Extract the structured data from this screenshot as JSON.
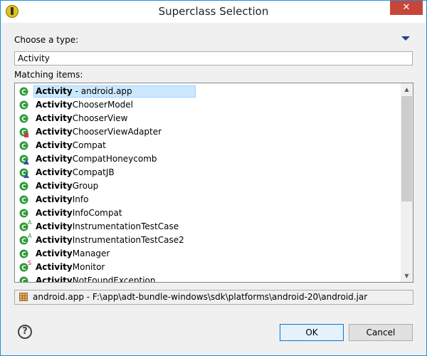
{
  "window": {
    "title": "Superclass Selection",
    "close_glyph": "✕"
  },
  "choose_label": "Choose a type:",
  "filter": {
    "value": "Activity",
    "placeholder": ""
  },
  "matching_label": "Matching items:",
  "items": [
    {
      "bold": "Activity",
      "rest": " - android.app",
      "icon": "class-icon",
      "overlay": "",
      "selected": true
    },
    {
      "bold": "Activity",
      "rest": "ChooserModel",
      "icon": "class-icon",
      "overlay": "",
      "selected": false
    },
    {
      "bold": "Activity",
      "rest": "ChooserView",
      "icon": "class-icon",
      "overlay": "",
      "selected": false
    },
    {
      "bold": "Activity",
      "rest": "ChooserViewAdapter",
      "icon": "class-icon",
      "overlay": "private-overlay",
      "selected": false
    },
    {
      "bold": "Activity",
      "rest": "Compat",
      "icon": "class-icon",
      "overlay": "",
      "selected": false
    },
    {
      "bold": "Activity",
      "rest": "CompatHoneycomb",
      "icon": "class-icon",
      "overlay": "default-overlay",
      "selected": false
    },
    {
      "bold": "Activity",
      "rest": "CompatJB",
      "icon": "class-icon",
      "overlay": "default-overlay",
      "selected": false
    },
    {
      "bold": "Activity",
      "rest": "Group",
      "icon": "class-icon",
      "overlay": "",
      "selected": false
    },
    {
      "bold": "Activity",
      "rest": "Info",
      "icon": "class-icon",
      "overlay": "",
      "selected": false
    },
    {
      "bold": "Activity",
      "rest": "InfoCompat",
      "icon": "class-icon",
      "overlay": "",
      "selected": false
    },
    {
      "bold": "Activity",
      "rest": "InstrumentationTestCase",
      "icon": "class-icon",
      "overlay": "abstract-overlay",
      "selected": false
    },
    {
      "bold": "Activity",
      "rest": "InstrumentationTestCase2",
      "icon": "class-icon",
      "overlay": "abstract-overlay",
      "selected": false
    },
    {
      "bold": "Activity",
      "rest": "Manager",
      "icon": "class-icon",
      "overlay": "",
      "selected": false
    },
    {
      "bold": "Activity",
      "rest": "Monitor",
      "icon": "class-icon",
      "overlay": "static-overlay",
      "selected": false
    },
    {
      "bold": "Activity",
      "rest": "NotFoundException",
      "icon": "class-icon",
      "overlay": "",
      "selected": false
    }
  ],
  "status": {
    "text": "android.app - F:\\app\\adt-bundle-windows\\sdk\\platforms\\android-20\\android.jar",
    "icon": "package-icon"
  },
  "buttons": {
    "ok": "OK",
    "cancel": "Cancel"
  },
  "help_glyph": "?",
  "colors": {
    "class_green": "#2f9a3a",
    "selection": "#cce8ff",
    "title_bar": "#ffffff",
    "close_red": "#c7463a"
  }
}
